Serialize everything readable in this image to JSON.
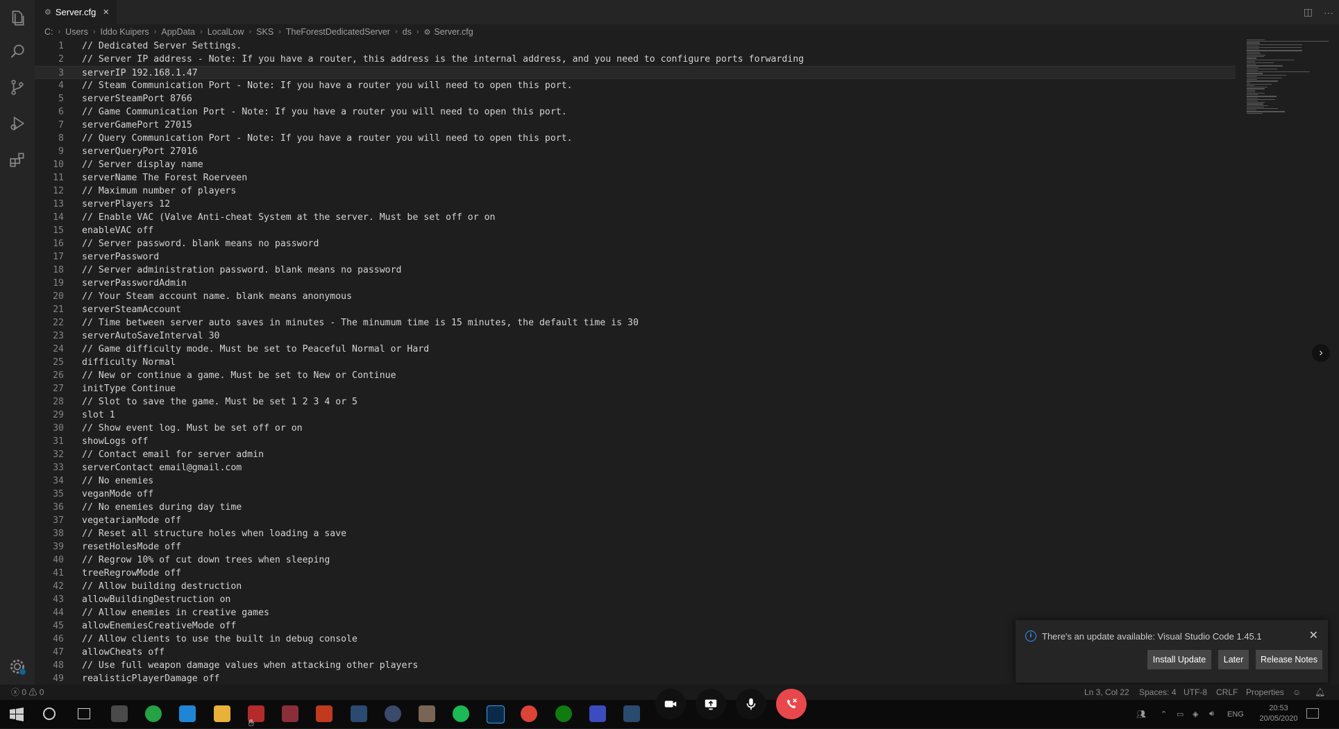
{
  "tab": {
    "title": "Server.cfg",
    "close": "×"
  },
  "breadcrumb": [
    "C:",
    "Users",
    "Iddo Kuipers",
    "AppData",
    "LocalLow",
    "SKS",
    "TheForestDedicatedServer",
    "ds",
    "Server.cfg"
  ],
  "editor": {
    "current_line": 3,
    "lines": [
      "// Dedicated Server Settings.",
      "// Server IP address - Note: If you have a router, this address is the internal address, and you need to configure ports forwarding",
      "serverIP 192.168.1.47",
      "// Steam Communication Port - Note: If you have a router you will need to open this port.",
      "serverSteamPort 8766",
      "// Game Communication Port - Note: If you have a router you will need to open this port.",
      "serverGamePort 27015",
      "// Query Communication Port - Note: If you have a router you will need to open this port.",
      "serverQueryPort 27016",
      "// Server display name",
      "serverName The Forest Roerveen",
      "// Maximum number of players",
      "serverPlayers 12",
      "// Enable VAC (Valve Anti-cheat System at the server. Must be set off or on",
      "enableVAC off",
      "// Server password. blank means no password",
      "serverPassword",
      "// Server administration password. blank means no password",
      "serverPasswordAdmin",
      "// Your Steam account name. blank means anonymous",
      "serverSteamAccount",
      "// Time between server auto saves in minutes - The minumum time is 15 minutes, the default time is 30",
      "serverAutoSaveInterval 30",
      "// Game difficulty mode. Must be set to Peaceful Normal or Hard",
      "difficulty Normal",
      "// New or continue a game. Must be set to New or Continue",
      "initType Continue",
      "// Slot to save the game. Must be set 1 2 3 4 or 5",
      "slot 1",
      "// Show event log. Must be set off or on",
      "showLogs off",
      "// Contact email for server admin",
      "serverContact email@gmail.com",
      "// No enemies",
      "veganMode off",
      "// No enemies during day time",
      "vegetarianMode off",
      "// Reset all structure holes when loading a save",
      "resetHolesMode off",
      "// Regrow 10% of cut down trees when sleeping",
      "treeRegrowMode off",
      "// Allow building destruction",
      "allowBuildingDestruction on",
      "// Allow enemies in creative games",
      "allowEnemiesCreativeMode off",
      "// Allow clients to use the built in debug console",
      "allowCheats off",
      "// Use full weapon damage values when attacking other players",
      "realisticPlayerDamage off"
    ]
  },
  "notification": {
    "message": "There's an update available: Visual Studio Code 1.45.1",
    "install_label": "Install Update",
    "later_label": "Later",
    "release_label": "Release Notes"
  },
  "statusbar": {
    "errors": "0",
    "warnings": "0",
    "cursor": "Ln 3, Col 22",
    "spaces": "Spaces: 4",
    "encoding": "UTF-8",
    "eol": "CRLF",
    "language": "Properties"
  },
  "taskbar": {
    "lang": "ENG",
    "time": "20:53",
    "date": "20/05/2020"
  },
  "colors": {
    "editor_bg": "#1e1e1e",
    "sidebar_bg": "#252526",
    "info_blue": "#3794ff",
    "hangup_red": "#e8484c"
  },
  "icons": [
    "files-icon",
    "search-icon",
    "source-control-icon",
    "run-icon",
    "extensions-icon",
    "settings-gear-icon",
    "windows-start-icon"
  ]
}
